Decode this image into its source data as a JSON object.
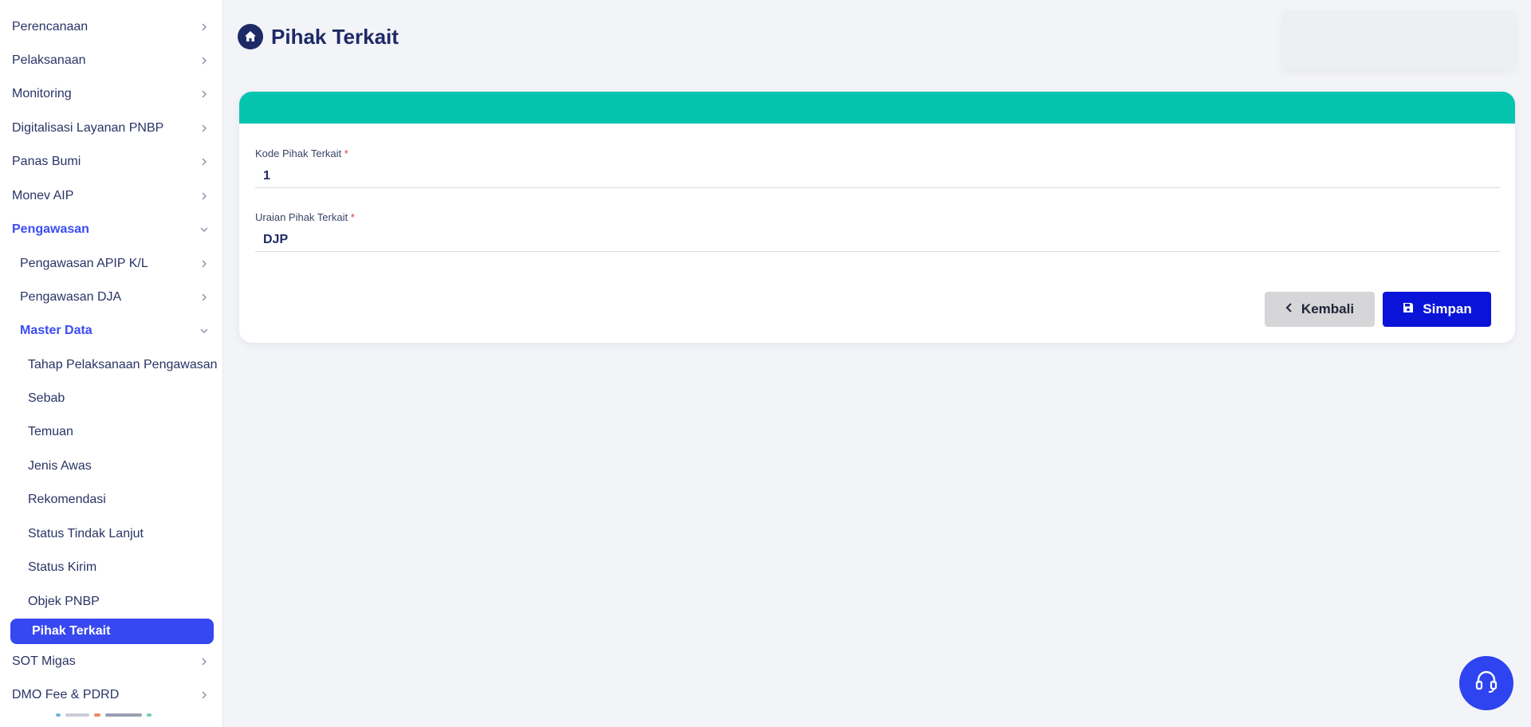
{
  "sidebar": {
    "items": [
      {
        "label": "Perencanaan"
      },
      {
        "label": "Pelaksanaan"
      },
      {
        "label": "Monitoring"
      },
      {
        "label": "Digitalisasi Layanan PNBP"
      },
      {
        "label": "Panas Bumi"
      },
      {
        "label": "Monev AIP"
      },
      {
        "label": "Pengawasan"
      },
      {
        "label": "Pengawasan APIP K/L"
      },
      {
        "label": "Pengawasan DJA"
      },
      {
        "label": "Master Data"
      },
      {
        "label": "Tahap Pelaksanaan Pengawasan"
      },
      {
        "label": "Sebab"
      },
      {
        "label": "Temuan"
      },
      {
        "label": "Jenis Awas"
      },
      {
        "label": "Rekomendasi"
      },
      {
        "label": "Status Tindak Lanjut"
      },
      {
        "label": "Status Kirim"
      },
      {
        "label": "Objek PNBP"
      },
      {
        "label": "Pihak Terkait"
      },
      {
        "label": "SOT Migas"
      },
      {
        "label": "DMO Fee & PDRD"
      }
    ]
  },
  "header": {
    "title": "Pihak Terkait",
    "icon": "home-icon"
  },
  "form": {
    "kode_label": "Kode Pihak Terkait",
    "kode_value": "1",
    "uraian_label": "Uraian Pihak Terkait",
    "uraian_value": "DJP",
    "required_mark": "*",
    "back_label": "Kembali",
    "save_label": "Simpan"
  },
  "colors": {
    "card_header": "#04c4ae",
    "primary": "#0a14d8",
    "active_nav": "#3748f0",
    "help_button": "#2e44f0"
  },
  "icons": {
    "help": "headset-icon",
    "save": "save-icon",
    "back": "chevron-left-icon",
    "chevron": "chevron-right-icon"
  }
}
